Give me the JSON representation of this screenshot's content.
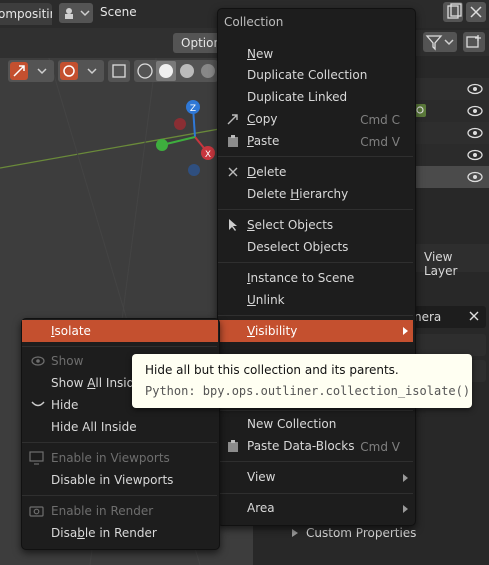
{
  "topbar": {
    "workspace_tab": "ompositing",
    "scene_label": "Scene"
  },
  "viewport": {
    "option_button": "Option",
    "gizmo_axes": [
      "Z",
      "X"
    ]
  },
  "outliner": {
    "view_layer_label": "View Layer",
    "field_value": "nera",
    "custom_properties": "Custom Properties"
  },
  "menu": {
    "title": "Collection",
    "items": [
      {
        "label": "New"
      },
      {
        "label": "Duplicate Collection"
      },
      {
        "label": "Duplicate Linked"
      },
      {
        "label": "Copy",
        "shortcut": "Cmd C"
      },
      {
        "label": "Paste",
        "shortcut": "Cmd V"
      },
      {
        "label": "Delete"
      },
      {
        "label": "Delete Hierarchy"
      },
      {
        "label": "Select Objects"
      },
      {
        "label": "Deselect Objects"
      },
      {
        "label": "Instance to Scene"
      },
      {
        "label": "Unlink"
      },
      {
        "label": "Visibility"
      },
      {
        "label": "New Collection"
      },
      {
        "label": "Paste Data-Blocks",
        "shortcut": "Cmd V"
      },
      {
        "label": "View"
      },
      {
        "label": "Area"
      }
    ]
  },
  "submenu": {
    "items": [
      {
        "label": "Isolate"
      },
      {
        "label": "Show"
      },
      {
        "label": "Show All Inside"
      },
      {
        "label": "Hide"
      },
      {
        "label": "Hide All Inside"
      },
      {
        "label": "Enable in Viewports"
      },
      {
        "label": "Disable in Viewports"
      },
      {
        "label": "Enable in Render"
      },
      {
        "label": "Disable in Render"
      }
    ]
  },
  "tooltip": {
    "description": "Hide all but this collection and its parents.",
    "python": "Python: bpy.ops.outliner.collection_isolate()"
  },
  "colors": {
    "highlight": "#c4502f",
    "menu_bg": "#1d1d1d",
    "tooltip_bg": "#fffff2"
  }
}
